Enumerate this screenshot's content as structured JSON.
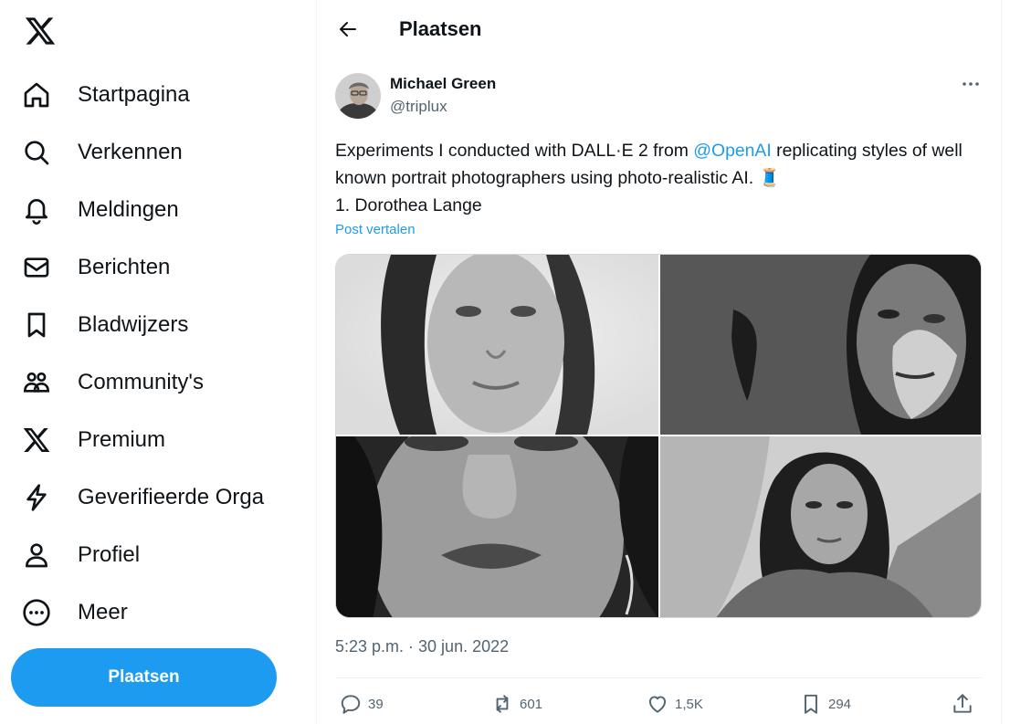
{
  "sidebar": {
    "logo": "x-logo-icon",
    "items": [
      {
        "label": "Startpagina",
        "icon": "home-icon"
      },
      {
        "label": "Verkennen",
        "icon": "search-icon"
      },
      {
        "label": "Meldingen",
        "icon": "bell-icon"
      },
      {
        "label": "Berichten",
        "icon": "mail-icon"
      },
      {
        "label": "Bladwijzers",
        "icon": "bookmark-icon"
      },
      {
        "label": "Community's",
        "icon": "communities-icon"
      },
      {
        "label": "Premium",
        "icon": "x-logo-icon"
      },
      {
        "label": "Geverifieerde Orga",
        "icon": "lightning-icon"
      },
      {
        "label": "Profiel",
        "icon": "profile-icon"
      },
      {
        "label": "Meer",
        "icon": "more-circle-icon"
      }
    ],
    "post_button": "Plaatsen"
  },
  "header": {
    "title": "Plaatsen"
  },
  "tweet": {
    "author_name": "Michael Green",
    "author_handle": "@triplux",
    "text_part1": "Experiments I conducted with DALL·E 2 from ",
    "mention": "@OpenAI",
    "text_part2": " replicating styles of well known portrait photographers using photo-realistic AI. 🧵",
    "text_line3": "1. Dorothea Lange",
    "translate": "Post vertalen",
    "timestamp": "5:23 p.m. · 30 jun. 2022",
    "stats": {
      "replies": "39",
      "reposts": "601",
      "likes": "1,5K",
      "bookmarks": "294"
    }
  },
  "colors": {
    "accent": "#1d9bf0",
    "text": "#0f1419",
    "muted": "#536471"
  }
}
